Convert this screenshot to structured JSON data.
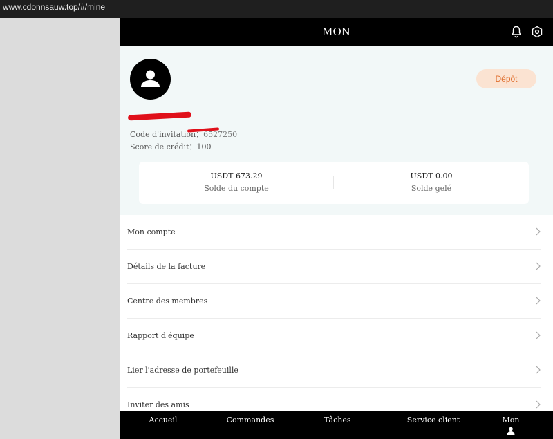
{
  "browser": {
    "url": "www.cdonnsauw.top/#/mine"
  },
  "header": {
    "title": "MON",
    "bell_icon": "bell-icon",
    "settings_icon": "gear-icon"
  },
  "profile": {
    "avatar_icon": "user-icon",
    "deposit_label": "Dépôt",
    "invite_label": "Code d'invitation：",
    "invite_value": "6527250",
    "credit_label": "Score de crédit：",
    "credit_value": "100"
  },
  "balances": {
    "account_amount": "USDT 673.29",
    "account_label": "Solde du compte",
    "frozen_amount": "USDT 0.00",
    "frozen_label": "Solde gelé"
  },
  "menu": {
    "items": [
      {
        "label": "Mon compte"
      },
      {
        "label": "Détails de la facture"
      },
      {
        "label": "Centre des membres"
      },
      {
        "label": "Rapport d'équipe"
      },
      {
        "label": "Lier l'adresse de portefeuille"
      },
      {
        "label": "Inviter des amis"
      }
    ]
  },
  "tabbar": {
    "items": [
      {
        "label": "Accueil"
      },
      {
        "label": "Commandes"
      },
      {
        "label": "Tâches"
      },
      {
        "label": "Service client"
      },
      {
        "label": "Mon"
      }
    ]
  },
  "colors": {
    "header_bg": "#000000",
    "profile_bg": "#f2f8f8",
    "deposit_bg": "#fbe3d2",
    "deposit_text": "#e07030"
  }
}
